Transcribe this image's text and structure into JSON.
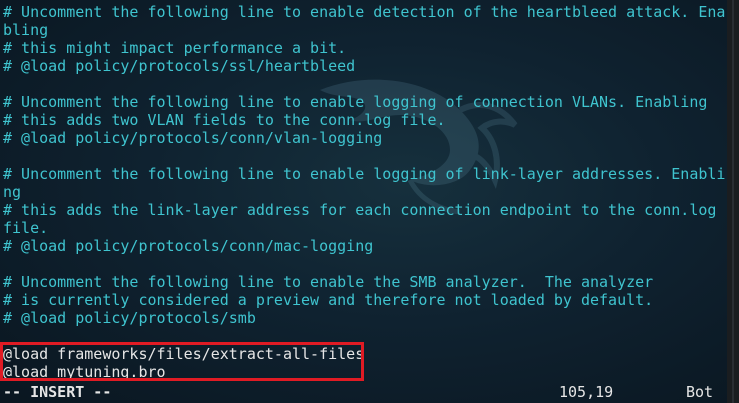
{
  "editor": {
    "lines": [
      "# Uncomment the following line to enable detection of the heartbleed attack. Ena",
      "bling",
      "# this might impact performance a bit.",
      "# @load policy/protocols/ssl/heartbleed",
      "",
      "# Uncomment the following line to enable logging of connection VLANs. Enabling",
      "# this adds two VLAN fields to the conn.log file.",
      "# @load policy/protocols/conn/vlan-logging",
      "",
      "# Uncomment the following line to enable logging of link-layer addresses. Enabli",
      "ng",
      "# this adds the link-layer address for each connection endpoint to the conn.log",
      "file.",
      "# @load policy/protocols/conn/mac-logging",
      "",
      "# Uncomment the following line to enable the SMB analyzer.  The analyzer",
      "# is currently considered a preview and therefore not loaded by default.",
      "# @load policy/protocols/smb",
      ""
    ],
    "code_lines": [
      "@load frameworks/files/extract-all-files",
      "@load mytuning.bro"
    ]
  },
  "status_bar": {
    "mode": "-- INSERT --",
    "position": "105,19",
    "scroll": "Bot"
  },
  "colors": {
    "comment": "#3fc4cf",
    "code": "#e6e6e6",
    "highlight_border": "#e01b24",
    "background": "#0b1821"
  }
}
